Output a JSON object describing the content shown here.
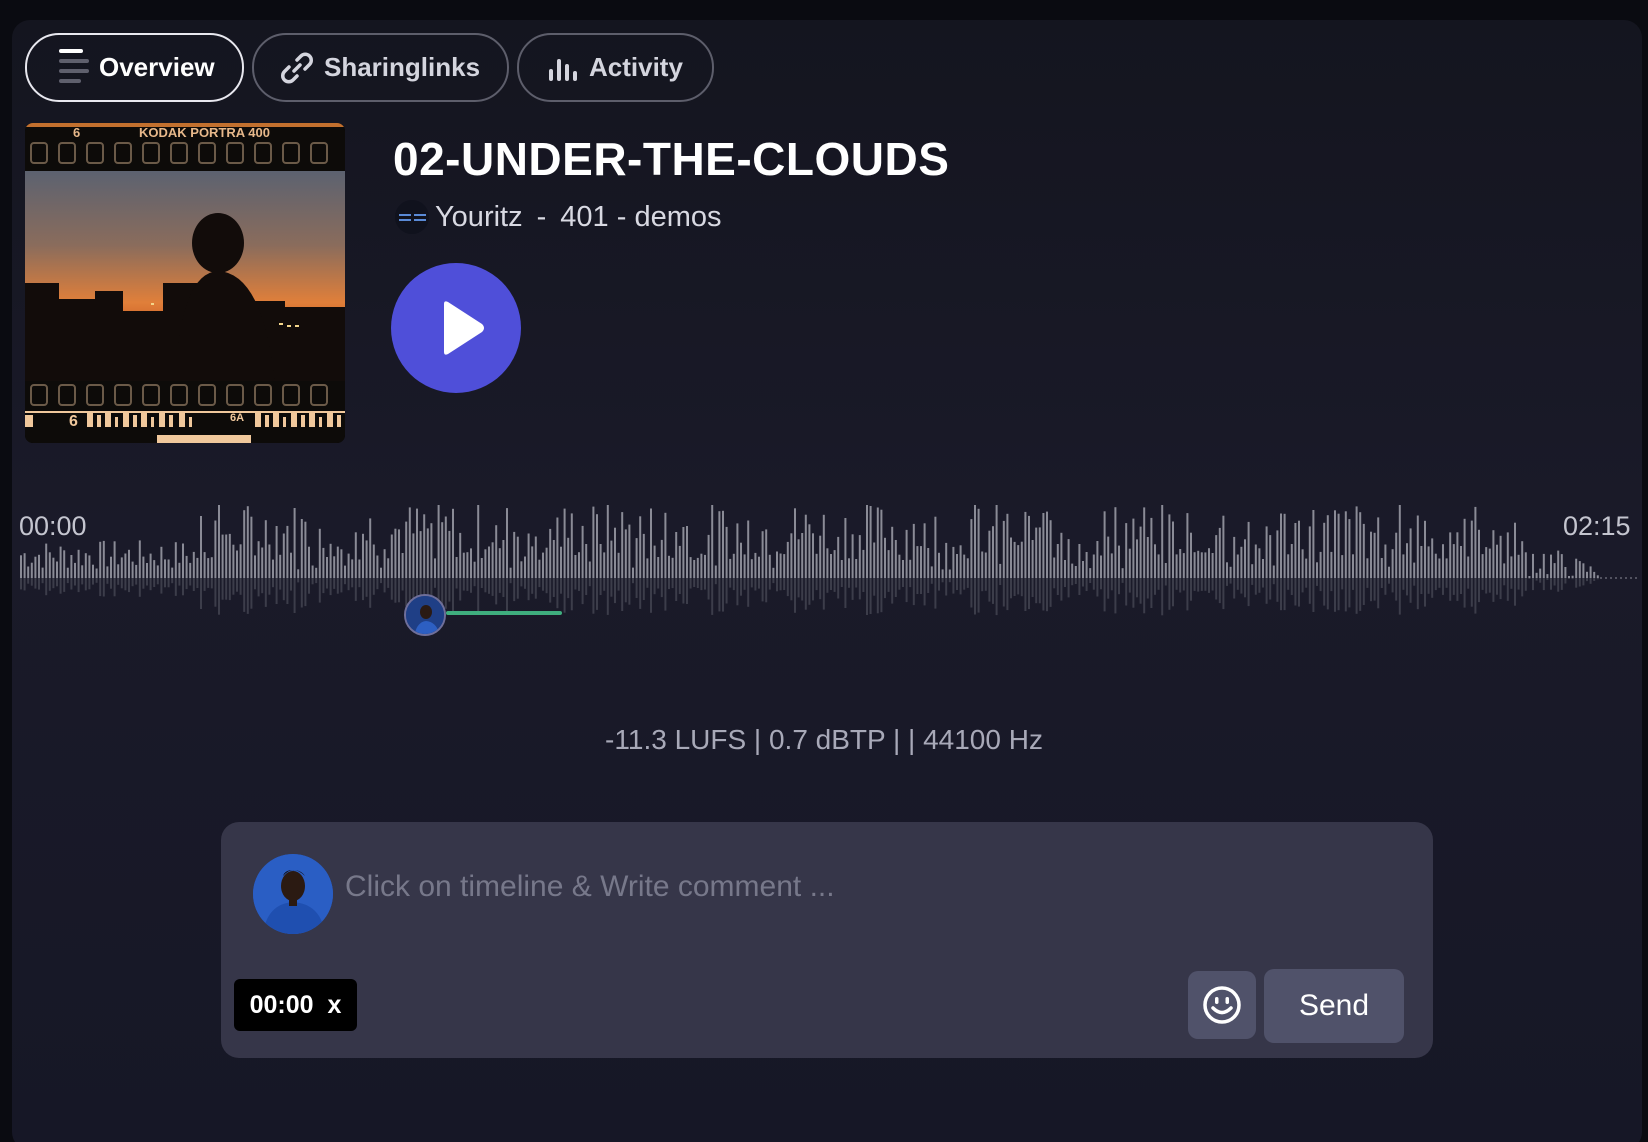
{
  "tabs": [
    {
      "label": "Overview",
      "icon": "menu-lines-icon",
      "active": true
    },
    {
      "label": "Sharinglinks",
      "icon": "link-icon",
      "active": false
    },
    {
      "label": "Activity",
      "icon": "bar-chart-icon",
      "active": false
    }
  ],
  "cover": {
    "film_label": "KODAK PORTRA 400",
    "frame_top": "6",
    "frame_bottom": "6",
    "frame_bottom_alt": "6A"
  },
  "track": {
    "title": "02-UNDER-THE-CLOUDS",
    "artist": "Youritz",
    "separator": "-",
    "project": "401 - demos"
  },
  "player": {
    "current_time": "00:00",
    "duration": "02:15",
    "play_icon": "play-icon"
  },
  "stats": "-11.3 LUFS | 0.7 dBTP | | 44100 Hz",
  "comment": {
    "placeholder": "Click on timeline & Write comment ...",
    "timestamp": "00:00",
    "clear_label": "x",
    "emoji_icon": "smiley-icon",
    "send_label": "Send"
  },
  "colors": {
    "accent": "#4f4fd9",
    "comment_line": "#3fae7e",
    "panel_bg": "#1a1a29",
    "comment_box": "#363649"
  }
}
